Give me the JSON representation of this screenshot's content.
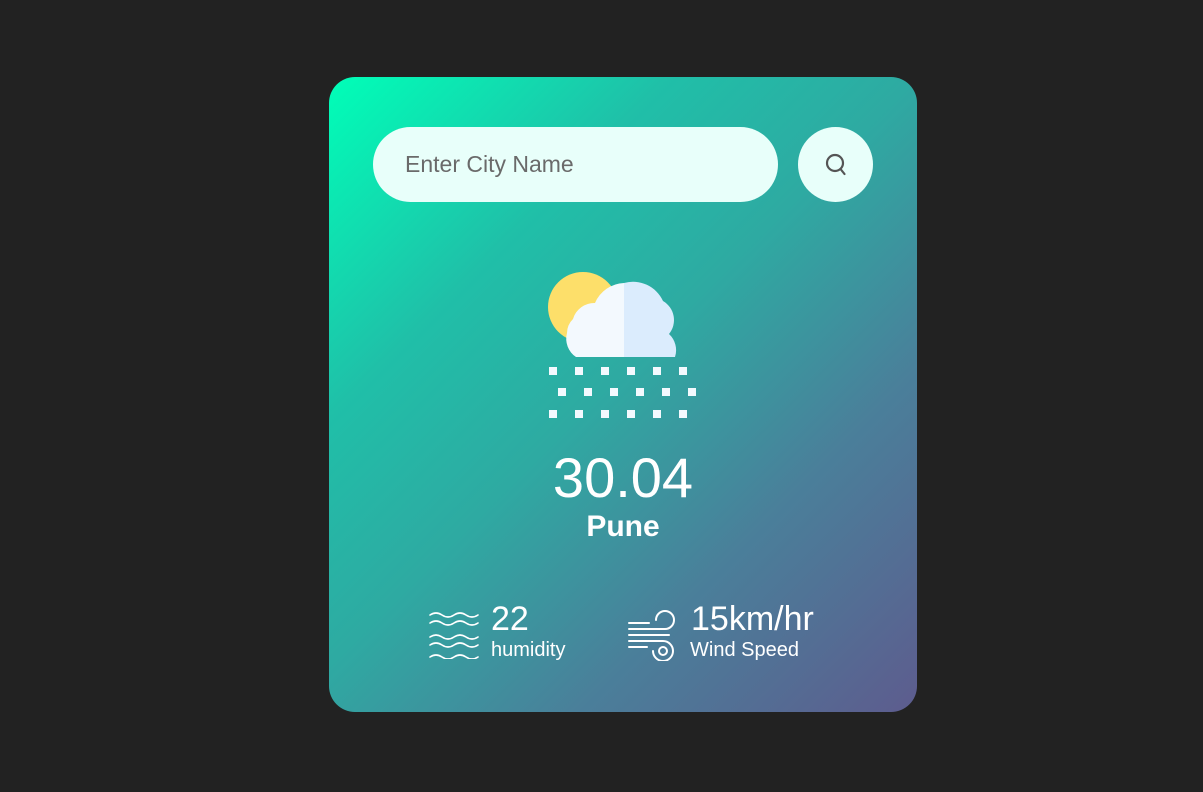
{
  "search": {
    "placeholder": "Enter City Name",
    "value": "",
    "button_icon": "search-icon"
  },
  "weather": {
    "icon": "snow-cloud-sun-icon",
    "temperature": "30.04",
    "city": "Pune"
  },
  "details": {
    "humidity": {
      "icon": "humidity-waves-icon",
      "value": "22",
      "label": "humidity"
    },
    "wind": {
      "icon": "wind-icon",
      "value": "15km/hr",
      "label": "Wind Speed"
    }
  },
  "colors": {
    "page_background": "#222222",
    "card_gradient_start": "#00ffb8",
    "card_gradient_end": "#5d5c8e",
    "input_background": "#e8fffa",
    "sun": "#fddf6a",
    "cloud_light": "#f3f9fe",
    "cloud_shade": "#dbecfd"
  }
}
